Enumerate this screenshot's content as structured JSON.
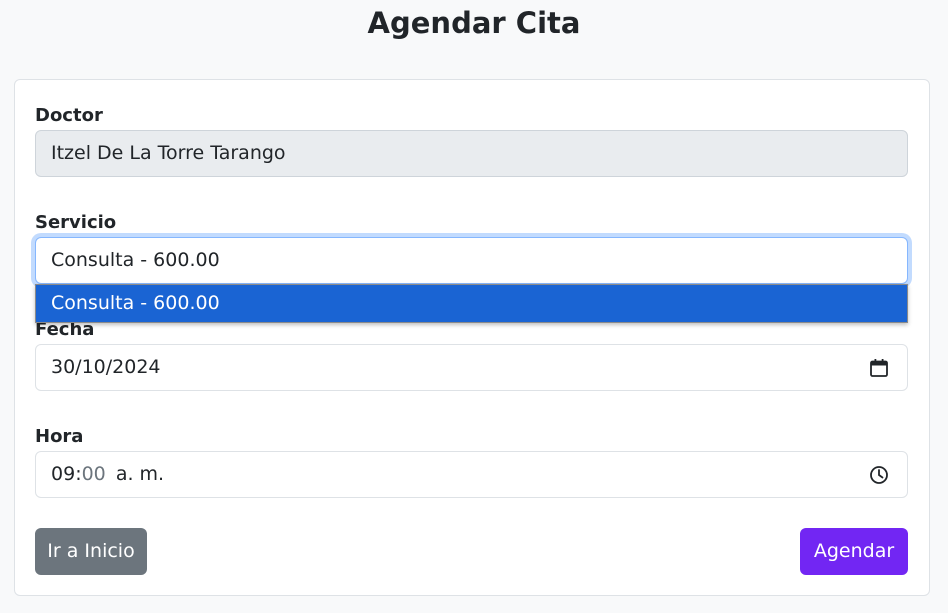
{
  "page": {
    "title": "Agendar Cita"
  },
  "form": {
    "doctor": {
      "label": "Doctor",
      "value": "Itzel De La Torre Tarango"
    },
    "servicio": {
      "label": "Servicio",
      "value": "Consulta - 600.00",
      "options": [
        "Consulta - 600.00"
      ],
      "highlighted_option": 0
    },
    "fecha": {
      "label": "Fecha",
      "value": "30/10/2024",
      "icon": "calendar-icon"
    },
    "hora": {
      "label": "Hora",
      "hours": "09",
      "separator": ":",
      "minutes": "00",
      "period": "a. m.",
      "icon": "clock-icon"
    }
  },
  "buttons": {
    "home_label": "Ir a Inicio",
    "submit_label": "Agendar"
  },
  "colors": {
    "primary": "#7226f3",
    "secondary": "#6c757d",
    "highlight": "#1a64d3",
    "focus_border": "#86b7fe"
  }
}
